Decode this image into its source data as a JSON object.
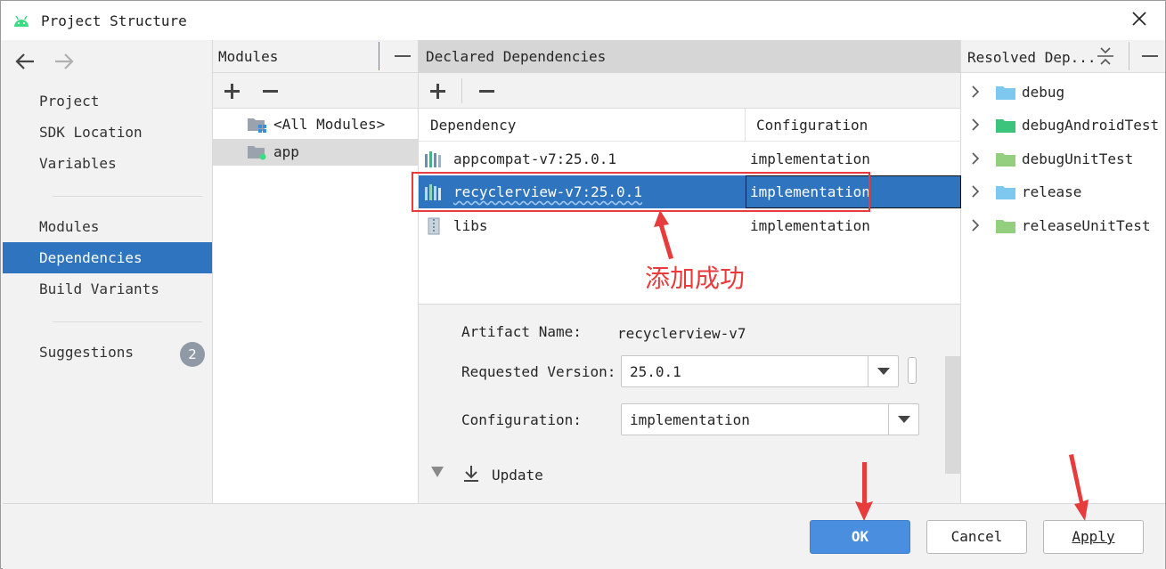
{
  "window": {
    "title": "Project Structure"
  },
  "nav": {
    "items": [
      {
        "label": "Project"
      },
      {
        "label": "SDK Location"
      },
      {
        "label": "Variables"
      },
      {
        "label": "Modules"
      },
      {
        "label": "Dependencies",
        "selected": true
      },
      {
        "label": "Build Variants"
      },
      {
        "label": "Suggestions"
      }
    ],
    "suggestions_count": "2"
  },
  "modules": {
    "header": "Modules",
    "items": [
      {
        "label": "<All Modules>"
      },
      {
        "label": "app",
        "selected": true
      }
    ]
  },
  "declared": {
    "header": "Declared Dependencies",
    "columns": [
      "Dependency",
      "Configuration"
    ],
    "rows": [
      {
        "name": "appcompat-v7:25.0.1",
        "config": "implementation"
      },
      {
        "name": "recyclerview-v7:25.0.1",
        "config": "implementation",
        "selected": true
      },
      {
        "name": "libs",
        "config": "implementation"
      }
    ],
    "annotation": "添加成功"
  },
  "details": {
    "artifact_label": "Artifact Name:",
    "artifact_value": "recyclerview-v7",
    "version_label": "Requested Version:",
    "version_value": "25.0.1",
    "config_label": "Configuration:",
    "config_value": "implementation",
    "update_label": "Update"
  },
  "resolved": {
    "header": "Resolved Dep...",
    "items": [
      {
        "label": "debug",
        "color": "#7ec8ef"
      },
      {
        "label": "debugAndroidTest",
        "color": "#3cc47c"
      },
      {
        "label": "debugUnitTest",
        "color": "#93cf7f"
      },
      {
        "label": "release",
        "color": "#7ec8ef"
      },
      {
        "label": "releaseUnitTest",
        "color": "#93cf7f"
      }
    ]
  },
  "footer": {
    "ok": "OK",
    "cancel": "Cancel",
    "apply": "Apply"
  },
  "colors": {
    "accent": "#2f74bf",
    "annotation": "#e83b3b",
    "android": "#3ddc84"
  }
}
